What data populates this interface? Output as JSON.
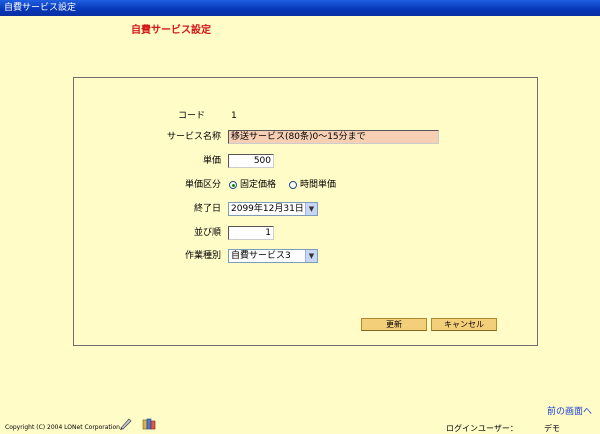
{
  "window": {
    "title": "自費サービス設定"
  },
  "page_title": "自費サービス設定",
  "form": {
    "code": {
      "label": "コード",
      "value": "1"
    },
    "service_name": {
      "label": "サービス名称",
      "value": "移送サービス(80条)0～15分まで"
    },
    "unit_price": {
      "label": "単価",
      "value": "500"
    },
    "price_type": {
      "label": "単価区分",
      "options": [
        {
          "label": "固定価格",
          "selected": true
        },
        {
          "label": "時間単価",
          "selected": false
        }
      ]
    },
    "end_date": {
      "label": "終了日",
      "value": "2099年12月31日"
    },
    "sort_order": {
      "label": "並び順",
      "value": "1"
    },
    "work_type": {
      "label": "作業種別",
      "value": "自費サービス3"
    }
  },
  "buttons": {
    "update": "更新",
    "cancel": "キャンセル"
  },
  "back_link": "前の画面へ",
  "footer": {
    "copyright": "Copyright (C) 2004 LONet Corporation",
    "login_user_label": "ログインユーザー：",
    "login_user_name": "デモ"
  },
  "colors": {
    "background": "#fffcc8",
    "title_red": "#d21818",
    "name_field": "#f7cfb4",
    "button": "#f4cf7a",
    "link": "#1a3fd0"
  }
}
